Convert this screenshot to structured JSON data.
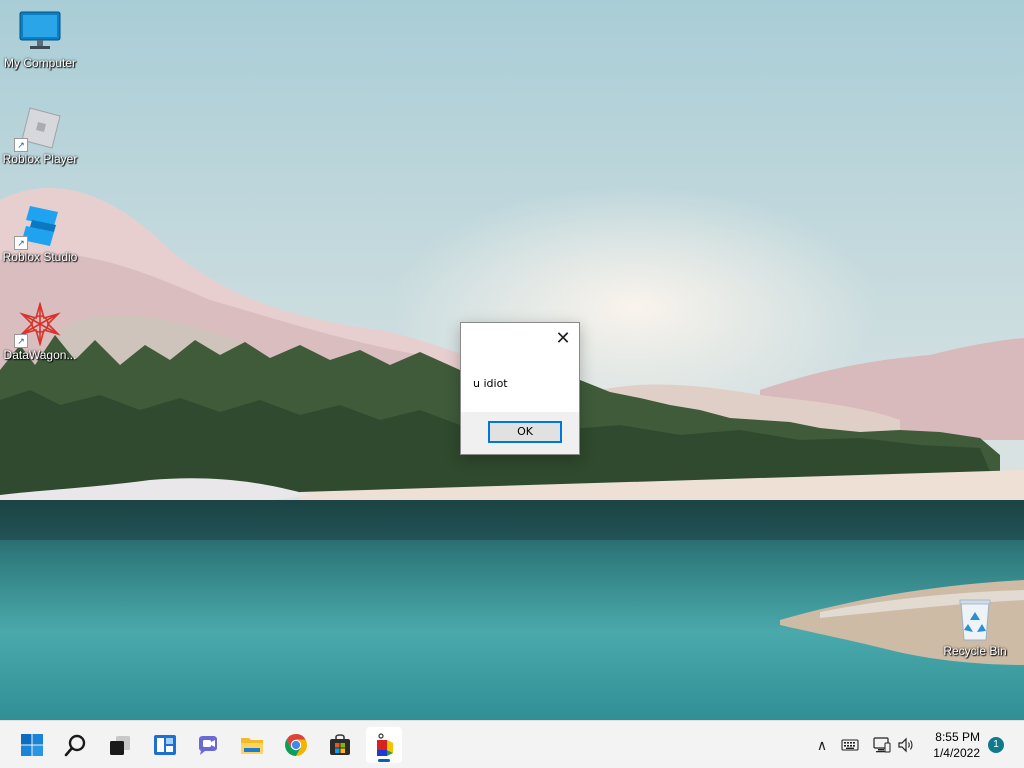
{
  "desktop": {
    "icons": [
      {
        "label": "My Computer",
        "icon": "monitor-icon"
      },
      {
        "label": "Roblox Player",
        "icon": "roblox-player-icon"
      },
      {
        "label": "Roblox Studio",
        "icon": "roblox-studio-icon"
      },
      {
        "label": "DataWagon...",
        "icon": "datawagon-icon"
      },
      {
        "label": "Recycle Bin",
        "icon": "recycle-bin-icon"
      }
    ]
  },
  "dialog": {
    "message": "u idiot",
    "ok_label": "OK",
    "close_glyph": "✕"
  },
  "taskbar": {
    "apps": [
      {
        "name": "start",
        "icon": "windows-start-icon"
      },
      {
        "name": "search",
        "icon": "search-icon"
      },
      {
        "name": "task-view",
        "icon": "task-view-icon"
      },
      {
        "name": "widgets",
        "icon": "widgets-icon"
      },
      {
        "name": "chat",
        "icon": "teams-chat-icon"
      },
      {
        "name": "file-explorer",
        "icon": "folder-icon"
      },
      {
        "name": "chrome",
        "icon": "chrome-icon"
      },
      {
        "name": "store",
        "icon": "store-icon"
      },
      {
        "name": "running-app",
        "icon": "app-cube-icon",
        "active": true
      }
    ],
    "tray": {
      "chevron": "∧",
      "time": "8:55 PM",
      "date": "1/4/2022",
      "notifications": "1"
    }
  },
  "colors": {
    "accent": "#0078d7",
    "taskbar_bg": "#f3f3f3",
    "sky": "#b9d6dc",
    "water": "#3f9ea2"
  }
}
